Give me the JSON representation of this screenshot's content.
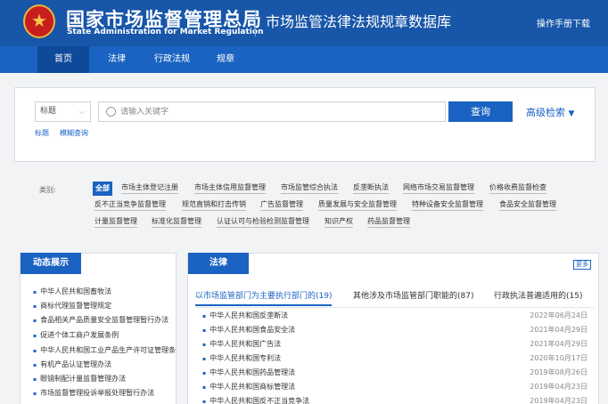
{
  "header": {
    "org_name": "国家市场监督管理总局",
    "org_name_en": "State Administration for Market Regulation",
    "db_title": "市场监管法律法规规章数据库",
    "manual_link": "操作手册下载"
  },
  "nav": {
    "items": [
      {
        "label": "首页",
        "active": true
      },
      {
        "label": "法律"
      },
      {
        "label": "行政法规"
      },
      {
        "label": "规章"
      }
    ]
  },
  "search": {
    "field_select": "标题",
    "placeholder": "请输入关键字",
    "query_button": "查询",
    "advanced": "高级检索",
    "option_title": "标题",
    "option_fuzzy": "模糊查询"
  },
  "categories": {
    "label": "类别:",
    "items": [
      "全部",
      "市场主体登记注册",
      "市场主体信用监督管理",
      "市场监管综合执法",
      "反垄断执法",
      "网络市场交易监督管理",
      "价格收费监督检查",
      "反不正当竞争监督管理",
      "规范直销和打击传销",
      "广告监督管理",
      "质量发展与安全监督管理",
      "特种设备安全监督管理",
      "食品安全监督管理",
      "计量监督管理",
      "标准化监督管理",
      "认证认可与检验检测监督管理",
      "知识产权",
      "药品监督管理"
    ]
  },
  "left_panel": {
    "title": "动态展示",
    "items": [
      "中华人民共和国畜牧法",
      "商标代理监督管理规定",
      "食品相关产品质量安全监督管理暂行办法",
      "促进个体工商户发展条例",
      "中华人民共和国工业产品生产许可证管理条例",
      "有机产品认证管理办法",
      "眼镜制配计量监督管理办法",
      "市场监督管理投诉举报处理暂行办法"
    ]
  },
  "law_panel": {
    "title": "法律",
    "more": "更多",
    "tabs": [
      {
        "label": "以市场监管部门为主要执行部门的(19)",
        "active": true
      },
      {
        "label": "其他涉及市场监管部门职能的(87)"
      },
      {
        "label": "行政执法普遍适用的(15)"
      }
    ],
    "rows": [
      {
        "title": "中华人民共和国反垄断法",
        "date": "2022年06月24日"
      },
      {
        "title": "中华人民共和国食品安全法",
        "date": "2021年04月29日"
      },
      {
        "title": "中华人民共和国广告法",
        "date": "2021年04月29日"
      },
      {
        "title": "中华人民共和国专利法",
        "date": "2020年10月17日"
      },
      {
        "title": "中华人民共和国药品管理法",
        "date": "2019年08月26日"
      },
      {
        "title": "中华人民共和国商标管理法",
        "date": "2019年04月23日"
      },
      {
        "title": "中华人民共和国反不正当竞争法",
        "date": "2019年04月23日"
      }
    ]
  },
  "colors": {
    "header_bg": "#1756a8",
    "nav_bg": "#1a63c2",
    "accent": "#1a63c2"
  }
}
